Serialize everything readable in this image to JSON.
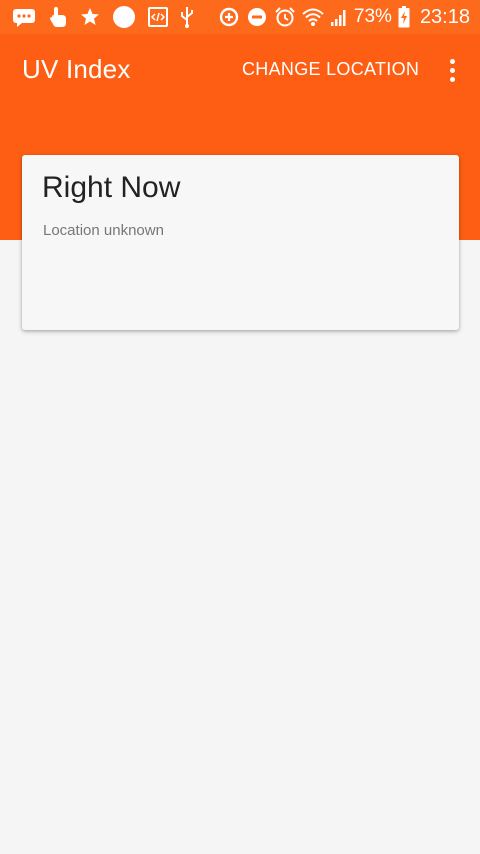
{
  "status_bar": {
    "left_icons": [
      "chat-icon",
      "touch-icon",
      "star-icon",
      "circle-icon",
      "code-icon",
      "usb-icon"
    ],
    "right_icons": [
      "data-saver-icon",
      "do-not-disturb-icon",
      "alarm-icon",
      "wifi-icon",
      "signal-icon"
    ],
    "battery_percent": "73%",
    "time": "23:18"
  },
  "app_bar": {
    "title": "UV Index",
    "action_label": "CHANGE LOCATION",
    "menu_icon": "more-vert-icon"
  },
  "card": {
    "title": "Right Now",
    "subtitle": "Location unknown"
  },
  "colors": {
    "primary": "#fe5e14",
    "status_bar": "#fd6a1c",
    "background": "#f5f5f5",
    "card": "#f7f7f7"
  }
}
